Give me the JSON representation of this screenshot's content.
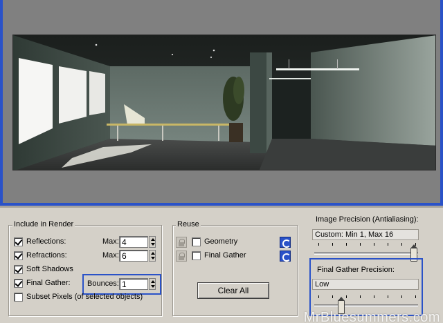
{
  "include_in_render": {
    "title": "Include in Render",
    "reflections": {
      "label": "Reflections:",
      "checked": true,
      "max_label": "Max:",
      "max_value": "4"
    },
    "refractions": {
      "label": "Refractions:",
      "checked": true,
      "max_label": "Max:",
      "max_value": "6"
    },
    "soft_shadows": {
      "label": "Soft Shadows",
      "checked": true
    },
    "final_gather": {
      "label": "Final Gather:",
      "checked": true,
      "bounces_label": "Bounces:",
      "bounces_value": "1"
    },
    "subset_pixels": {
      "label": "Subset Pixels (of selected objects)",
      "checked": false
    }
  },
  "reuse": {
    "title": "Reuse",
    "geometry": {
      "label": "Geometry",
      "checked": false
    },
    "final_gather": {
      "label": "Final Gather",
      "checked": false
    },
    "clear_all_label": "Clear All"
  },
  "image_precision": {
    "title": "Image Precision (Antialiasing):",
    "value": "Custom: Min 1, Max 16",
    "slider_level": 1.0
  },
  "final_gather_precision": {
    "title": "Final Gather Precision:",
    "value": "Low",
    "slider_level": 0.25
  },
  "watermark": "MrBluesummers.com",
  "colors": {
    "highlight": "#2a52c8",
    "panel": "#d4d0c8",
    "viewport": "#808080"
  }
}
